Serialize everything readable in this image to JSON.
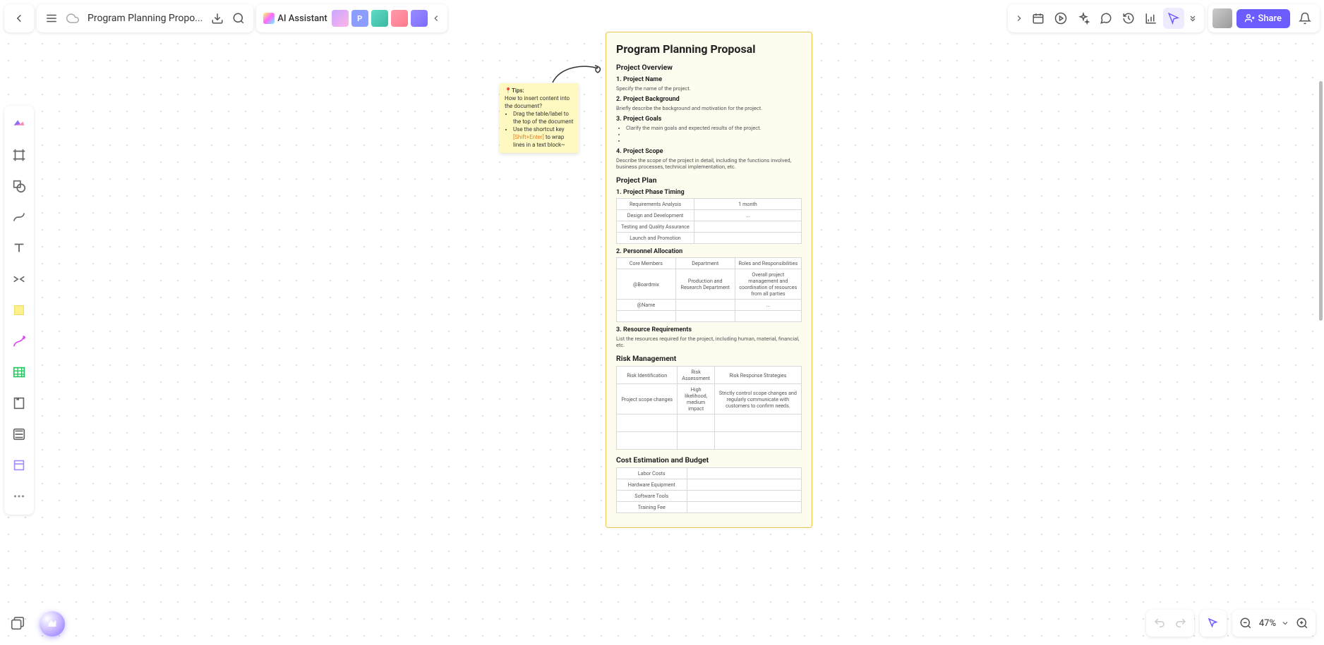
{
  "header": {
    "doc_title": "Program Planning Propo...",
    "ai_label": "AI Assistant",
    "share_label": "Share",
    "collab_chips": [
      {
        "letter": "",
        "bg": "linear-gradient(135deg,#c9a8ff,#ffb3e6)"
      },
      {
        "letter": "P",
        "bg": "#8c9dff"
      },
      {
        "letter": "",
        "bg": "linear-gradient(135deg,#5edcc4,#3db8a0)"
      },
      {
        "letter": "",
        "bg": "linear-gradient(135deg,#ff9ab0,#ff7a8a)"
      },
      {
        "letter": "",
        "bg": "linear-gradient(135deg,#9b8cff,#7b6cff)"
      }
    ]
  },
  "zoom": {
    "level": "47%"
  },
  "sticky": {
    "title": "📍Tips:",
    "subtitle": "How to insert content into the document?",
    "bullet1": "Drag the table/label to the top of the document",
    "bullet2a": "Use the shortcut key ",
    "bullet2b": "[Shift+Enter]",
    "bullet2c": " to wrap lines in a text block~"
  },
  "doc": {
    "title": "Program Planning Proposal",
    "s1": {
      "heading": "Project Overview",
      "h1": "1. Project Name",
      "p1": "Specify the name of the project.",
      "h2": "2. Project Background",
      "p2": "Briefly describe the background and motivation for the project.",
      "h3": "3. Project Goals",
      "li1": "Clarify the main goals and expected results of the project.",
      "h4": "4. Project Scope",
      "p4": "Describe the scope of the project in detail, including the functions involved, business processes, technical implementation, etc."
    },
    "s2": {
      "heading": "Project Plan",
      "h1": "1. Project Phase Timing",
      "timing": {
        "r1c1": "Requirements Analysis",
        "r1c2": "1 month",
        "r2c1": "Design and Development",
        "r2c2": "...",
        "r3c1": "Testing and Quality Assurance",
        "r3c2": "",
        "r4c1": "Launch and Promotion",
        "r4c2": ""
      },
      "h2": "2. Personnel Allocation",
      "personnel": {
        "th1": "Core Members",
        "th2": "Department",
        "th3": "Roles and Responsibilities",
        "r1c1": "@Boardmix",
        "r1c2": "Production and Research Department",
        "r1c3": "Overall project management and coordination of resources from all parties",
        "r2c1": "@Name",
        "r2c2": "",
        "r2c3": "...",
        "r3c1": "",
        "r3c2": "",
        "r3c3": ""
      },
      "h3": "3. Resource Requirements",
      "p3": "List the resources required for the project, including human, material, financial, etc."
    },
    "s3": {
      "heading": "Risk Management",
      "risk": {
        "th1": "Risk Identification",
        "th2": "Risk Assessment",
        "th3": "Risk Response Strategies",
        "r1c1": "Project scope changes",
        "r1c2": "High likelihood, medium impact",
        "r1c3": "Strictly control scope changes and regularly communicate with customers to confirm needs.",
        "r2c1": "",
        "r2c2": "",
        "r2c3": "",
        "r3c1": "",
        "r3c2": "",
        "r3c3": ""
      }
    },
    "s4": {
      "heading": "Cost Estimation and Budget",
      "cost": {
        "r1c1": "Labor Costs",
        "r1c2": "",
        "r2c1": "Hardware Equipment",
        "r2c2": "",
        "r3c1": "Software Tools",
        "r3c2": "",
        "r4c1": "Training Fee",
        "r4c2": ""
      }
    }
  }
}
